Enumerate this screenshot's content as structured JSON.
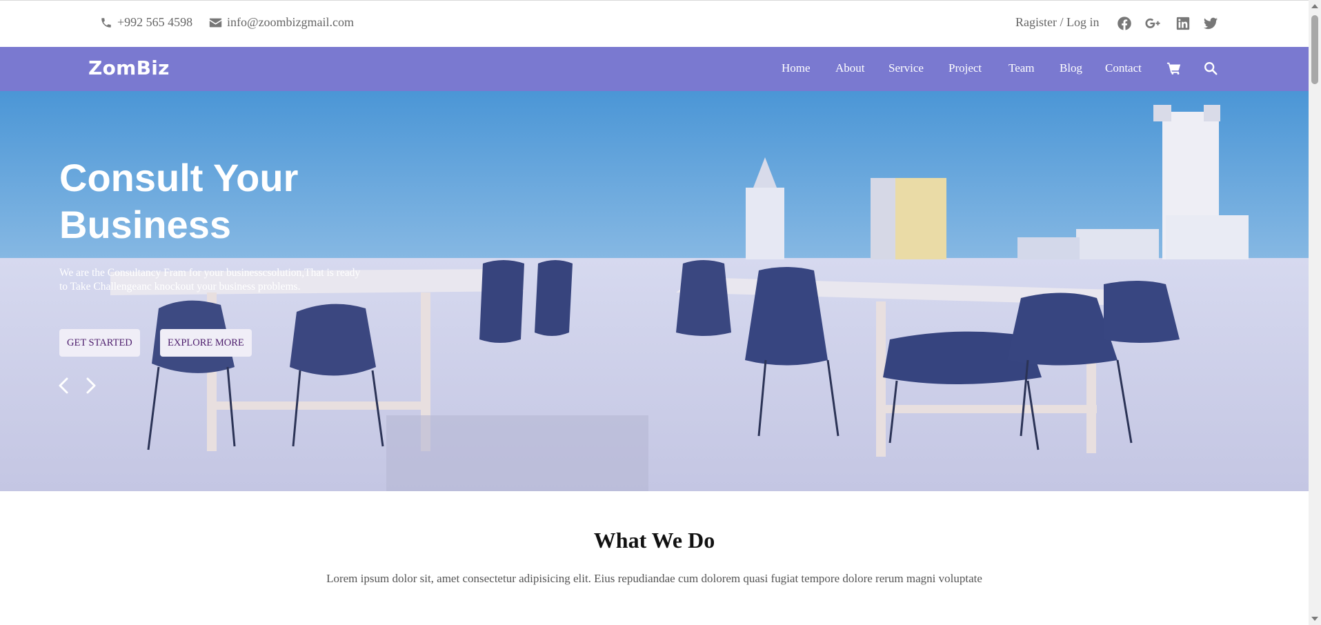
{
  "topbar": {
    "phone": "+992 565 4598",
    "email": "info@zoombizgmail.com",
    "register": "Ragister / Log in",
    "social_icons": [
      "facebook-icon",
      "google-plus-icon",
      "linkedin-icon",
      "twitter-icon"
    ]
  },
  "navbar": {
    "logo": "ZomBiz",
    "links": [
      "Home",
      "About",
      "Service",
      "Project",
      "Team",
      "Blog",
      "Contact"
    ],
    "icons": [
      "cart-icon",
      "search-icon"
    ],
    "background_color": "#7a79d0"
  },
  "hero": {
    "title_line1": "Consult Your",
    "title_line2": "Business",
    "subtitle_line1": "We are the Consultancy Fram for your businesscsolution,That is ready",
    "subtitle_line2": "to Take Challengeanc knockout your business problems.",
    "btn_primary": "GET STARTED",
    "btn_secondary": "EXPLORE MORE",
    "prev_icon": "chevron-left-icon",
    "next_icon": "chevron-right-icon"
  },
  "what_we_do": {
    "title": "What We Do",
    "text": "Lorem ipsum dolor sit, amet consectetur adipisicing elit. Eius repudiandae cum dolorem quasi fugiat tempore dolore rerum magni voluptate"
  }
}
